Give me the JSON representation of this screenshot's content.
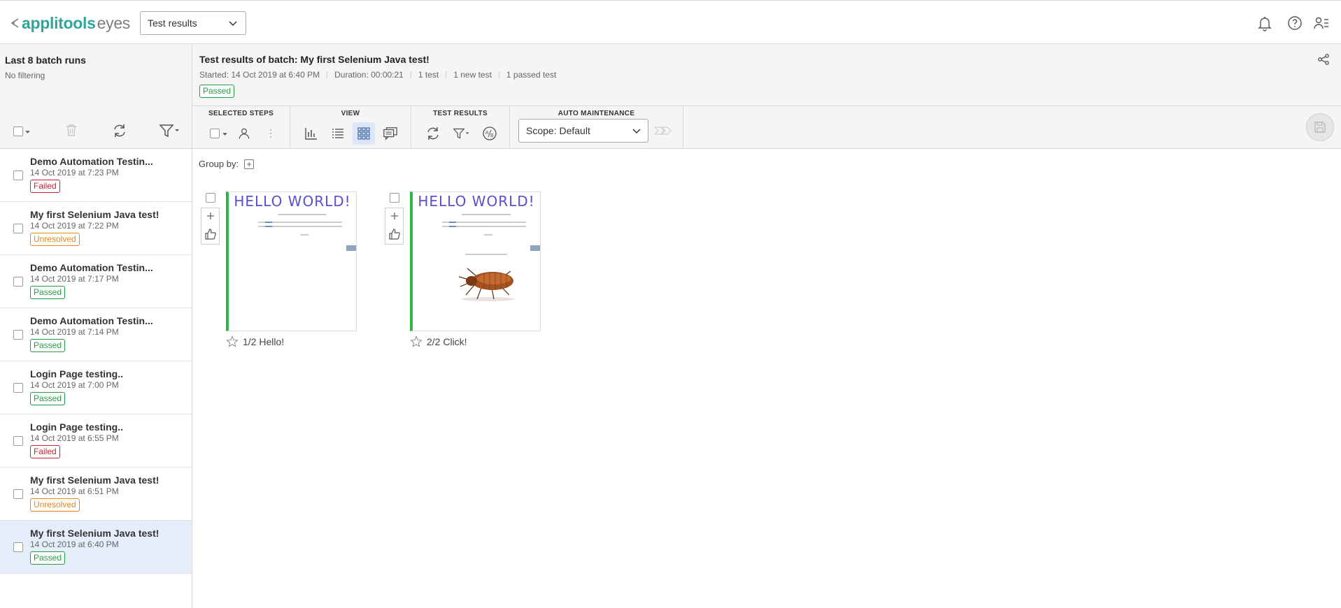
{
  "app": {
    "logo_brand": "applitools",
    "logo_product": "eyes",
    "brand_color": "#2fa79a",
    "view_select": "Test results",
    "header_icons": [
      "bell-icon",
      "help-icon",
      "user-menu-icon"
    ]
  },
  "left_panel": {
    "title": "Last 8 batch runs",
    "filter_status": "No filtering",
    "tools": [
      "select-all-checkbox",
      "trash-icon",
      "refresh-icon",
      "filter-icon"
    ],
    "batches": [
      {
        "name": "Demo Automation Testin...",
        "date": "14 Oct 2019 at 7:23 PM",
        "status": "Failed"
      },
      {
        "name": "My first Selenium Java test!",
        "date": "14 Oct 2019 at 7:22 PM",
        "status": "Unresolved"
      },
      {
        "name": "Demo Automation Testin...",
        "date": "14 Oct 2019 at 7:17 PM",
        "status": "Passed"
      },
      {
        "name": "Demo Automation Testin...",
        "date": "14 Oct 2019 at 7:14 PM",
        "status": "Passed"
      },
      {
        "name": "Login Page testing..",
        "date": "14 Oct 2019 at 7:00 PM",
        "status": "Passed"
      },
      {
        "name": "Login Page testing..",
        "date": "14 Oct 2019 at 6:55 PM",
        "status": "Failed"
      },
      {
        "name": "My first Selenium Java test!",
        "date": "14 Oct 2019 at 6:51 PM",
        "status": "Unresolved"
      },
      {
        "name": "My first Selenium Java test!",
        "date": "14 Oct 2019 at 6:40 PM",
        "status": "Passed"
      }
    ]
  },
  "batch": {
    "title": "Test results of batch: My first Selenium Java test!",
    "started": "Started: 14 Oct 2019 at 6:40 PM",
    "duration": "Duration: 00:00:21",
    "tests": "1 test",
    "new_tests": "1 new test",
    "passed_tests": "1 passed test",
    "status": "Passed"
  },
  "toolbar": {
    "selected_steps_label": "SELECTED STEPS",
    "view_label": "VIEW",
    "test_results_label": "TEST RESULTS",
    "auto_maintenance_label": "AUTO MAINTENANCE",
    "scope_value": "Scope: Default"
  },
  "content": {
    "group_by_label": "Group by:",
    "steps": [
      {
        "label": "1/2 Hello!",
        "hello_text": "HELLO WORLD!"
      },
      {
        "label": "2/2 Click!",
        "hello_text": "HELLO WORLD!"
      }
    ]
  },
  "colors": {
    "passed": "#279c42",
    "failed": "#cc2233",
    "unresolved": "#e8861c",
    "selected_row": "#e4eefb"
  }
}
